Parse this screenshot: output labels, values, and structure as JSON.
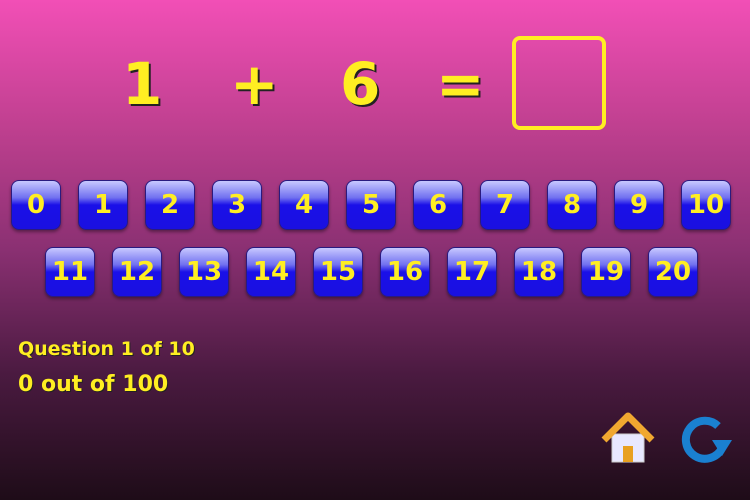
{
  "equation": {
    "left": "1",
    "operator": "+",
    "right": "6",
    "equals": "=",
    "answer": ""
  },
  "row1": [
    "0",
    "1",
    "2",
    "3",
    "4",
    "5",
    "6",
    "7",
    "8",
    "9",
    "10"
  ],
  "row2": [
    "11",
    "12",
    "13",
    "14",
    "15",
    "16",
    "17",
    "18",
    "19",
    "20"
  ],
  "status": {
    "question": "Question 1 of 10",
    "score": "0 out of 100"
  },
  "icons": {
    "home": "home-icon",
    "restart": "refresh-icon"
  },
  "colors": {
    "accent": "#ffee22",
    "button": "#1a10e8"
  }
}
